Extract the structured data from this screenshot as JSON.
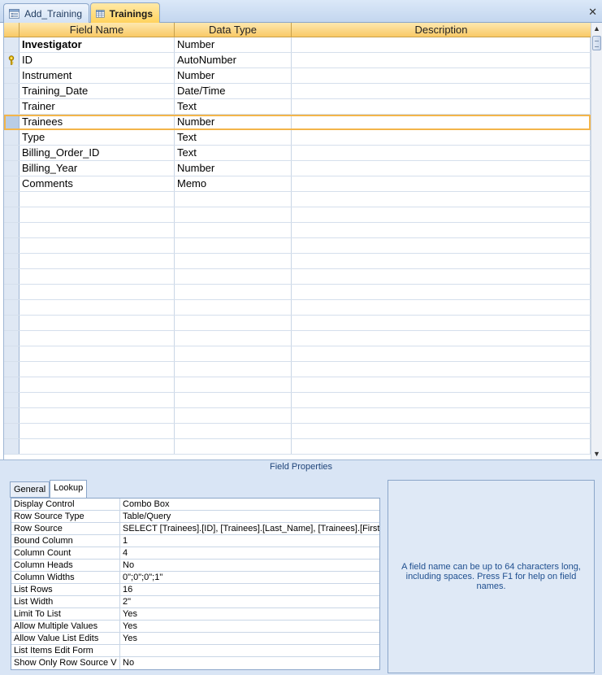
{
  "tabs": [
    {
      "label": "Add_Training",
      "icon": "form-icon",
      "active": false
    },
    {
      "label": "Trainings",
      "icon": "table-icon",
      "active": true
    }
  ],
  "grid": {
    "headers": [
      "Field Name",
      "Data Type",
      "Description"
    ],
    "rows": [
      {
        "name": "Investigator",
        "type": "Number",
        "description": ""
      },
      {
        "name": "ID",
        "type": "AutoNumber",
        "description": "",
        "primary_key": true
      },
      {
        "name": "Instrument",
        "type": "Number",
        "description": ""
      },
      {
        "name": "Training_Date",
        "type": "Date/Time",
        "description": ""
      },
      {
        "name": "Trainer",
        "type": "Text",
        "description": ""
      },
      {
        "name": "Trainees",
        "type": "Number",
        "description": ""
      },
      {
        "name": "Type",
        "type": "Text",
        "description": ""
      },
      {
        "name": "Billing_Order_ID",
        "type": "Text",
        "description": ""
      },
      {
        "name": "Billing_Year",
        "type": "Number",
        "description": ""
      },
      {
        "name": "Comments",
        "type": "Memo",
        "description": ""
      }
    ]
  },
  "field_properties": {
    "title": "Field Properties",
    "tabs": [
      "General",
      "Lookup"
    ],
    "active_tab": "Lookup",
    "properties": [
      {
        "name": "Display Control",
        "value": "Combo Box"
      },
      {
        "name": "Row Source Type",
        "value": "Table/Query"
      },
      {
        "name": "Row Source",
        "value": "SELECT [Trainees].[ID], [Trainees].[Last_Name], [Trainees].[First_N"
      },
      {
        "name": "Bound Column",
        "value": "1"
      },
      {
        "name": "Column Count",
        "value": "4"
      },
      {
        "name": "Column Heads",
        "value": "No"
      },
      {
        "name": "Column Widths",
        "value": "0\";0\";0\";1\""
      },
      {
        "name": "List Rows",
        "value": "16"
      },
      {
        "name": "List Width",
        "value": "2\""
      },
      {
        "name": "Limit To List",
        "value": "Yes"
      },
      {
        "name": "Allow Multiple Values",
        "value": "Yes"
      },
      {
        "name": "Allow Value List Edits",
        "value": "Yes"
      },
      {
        "name": "List Items Edit Form",
        "value": ""
      },
      {
        "name": "Show Only Row Source V",
        "value": "No"
      }
    ],
    "help_text": "A field name can be up to 64 characters long, including spaces.  Press F1 for help on field names."
  },
  "colors": {
    "accent": "#f9c966",
    "current_row_outline": "#f3b54a",
    "panel_bg": "#d9e5f5"
  }
}
